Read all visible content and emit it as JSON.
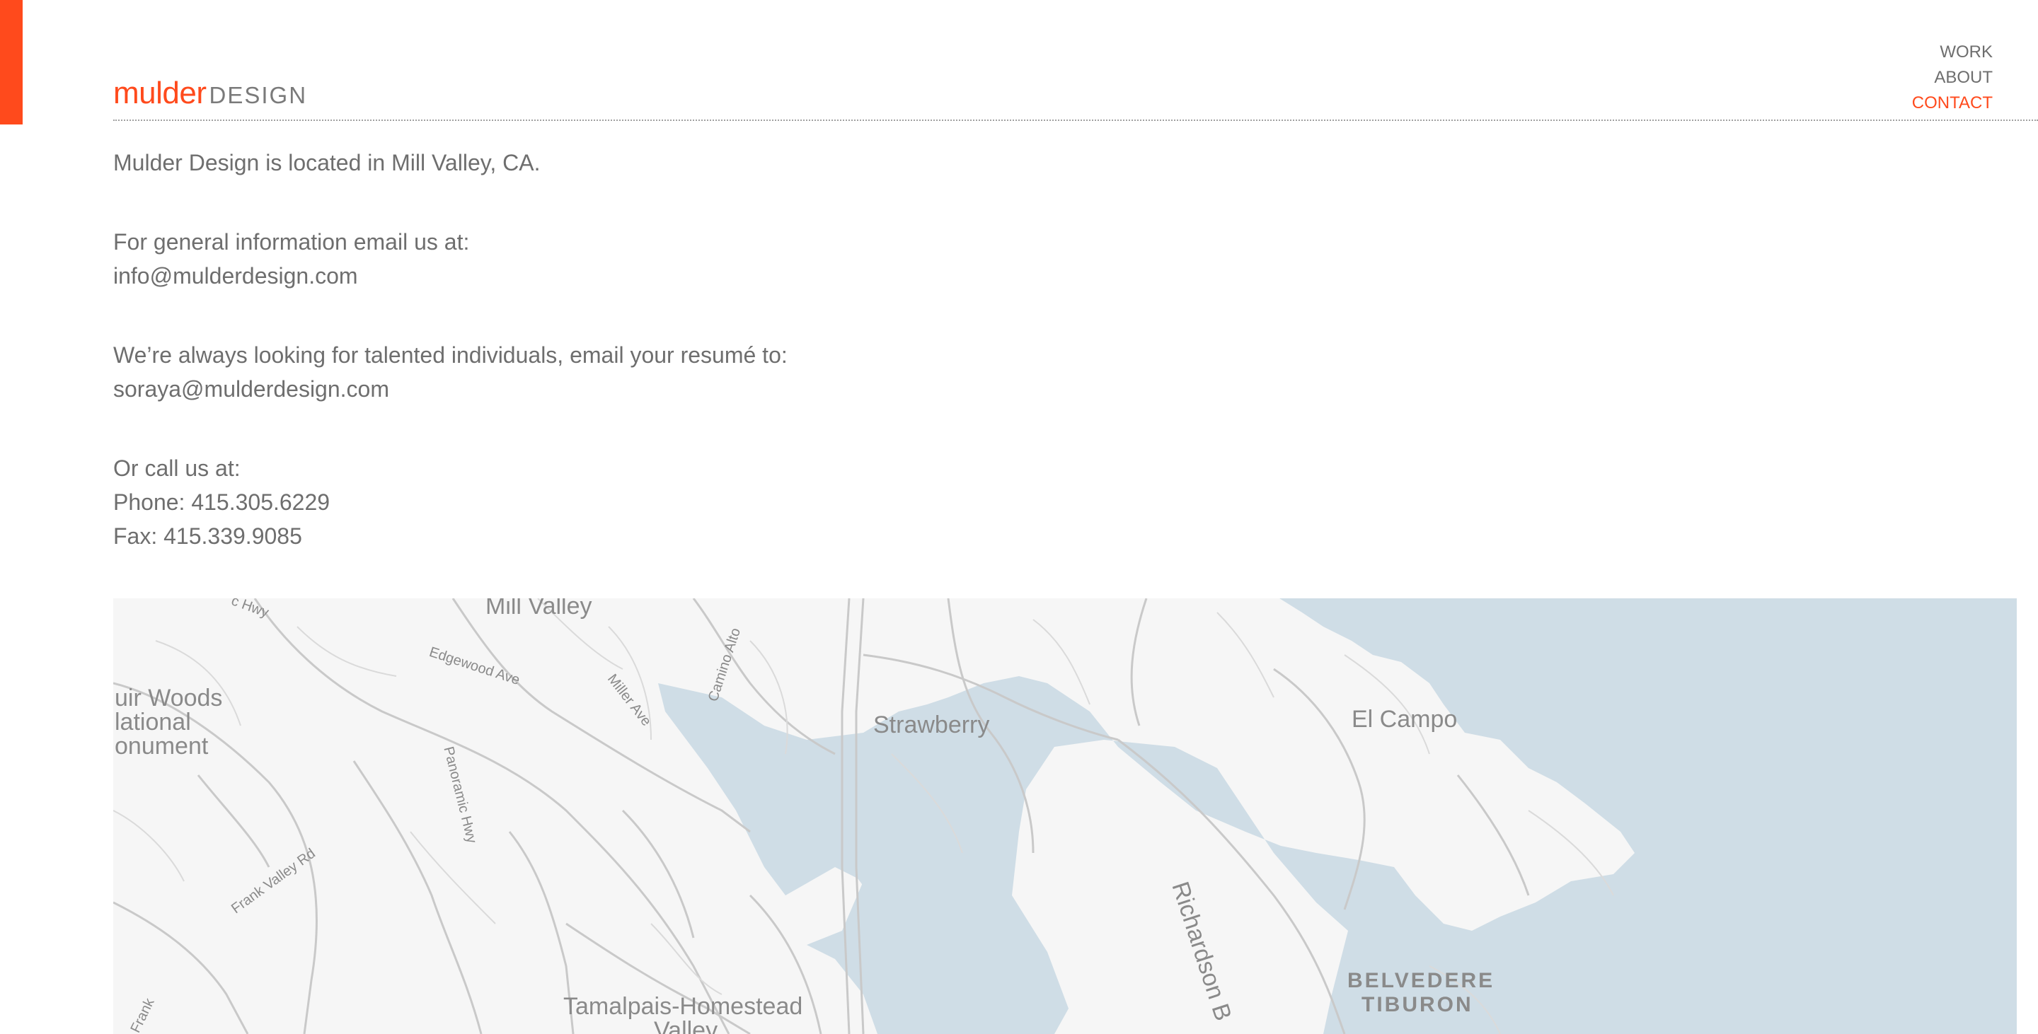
{
  "brand": {
    "logo_main": "mulder",
    "logo_sub": "DESIGN",
    "accent_color": "#ff4a1c"
  },
  "nav": {
    "items": [
      {
        "label": "WORK",
        "active": false
      },
      {
        "label": "ABOUT",
        "active": false
      },
      {
        "label": "CONTACT",
        "active": true
      }
    ]
  },
  "contact": {
    "location": "Mulder Design is located in Mill Valley, CA.",
    "general_intro": "For general information email us at:",
    "general_email": "info@mulderdesign.com",
    "jobs_intro": "We’re always looking for talented individuals, email your resumé to:",
    "jobs_email": "soraya@mulderdesign.com",
    "call_intro": "Or call us at:",
    "phone": "Phone: 415.305.6229",
    "fax": "Fax: 415.339.9085"
  },
  "map": {
    "water_color": "#cfdde6",
    "land_color": "#f6f6f6",
    "labels": {
      "mill_valley": "Mill Valley",
      "muir_woods_1": "uir Woods",
      "muir_woods_2": "lational",
      "muir_woods_3": "onument",
      "edgewood": "Edgewood Ave",
      "miller": "Miller Ave",
      "camino_alto": "Camino Alto",
      "strawberry": "Strawberry",
      "el_campo": "El Campo",
      "panoramic": "Panoramic Hwy",
      "frank_valley": "Frank Valley Rd",
      "frank": "Frank",
      "richardson": "Richardson B",
      "belvedere": "BELVEDERE",
      "tiburon": "TIBURON",
      "tamalpais_1": "Tamalpais-Homestead",
      "tamalpais_2": "Valley",
      "shoreline_hwy": "c Hwy"
    }
  }
}
